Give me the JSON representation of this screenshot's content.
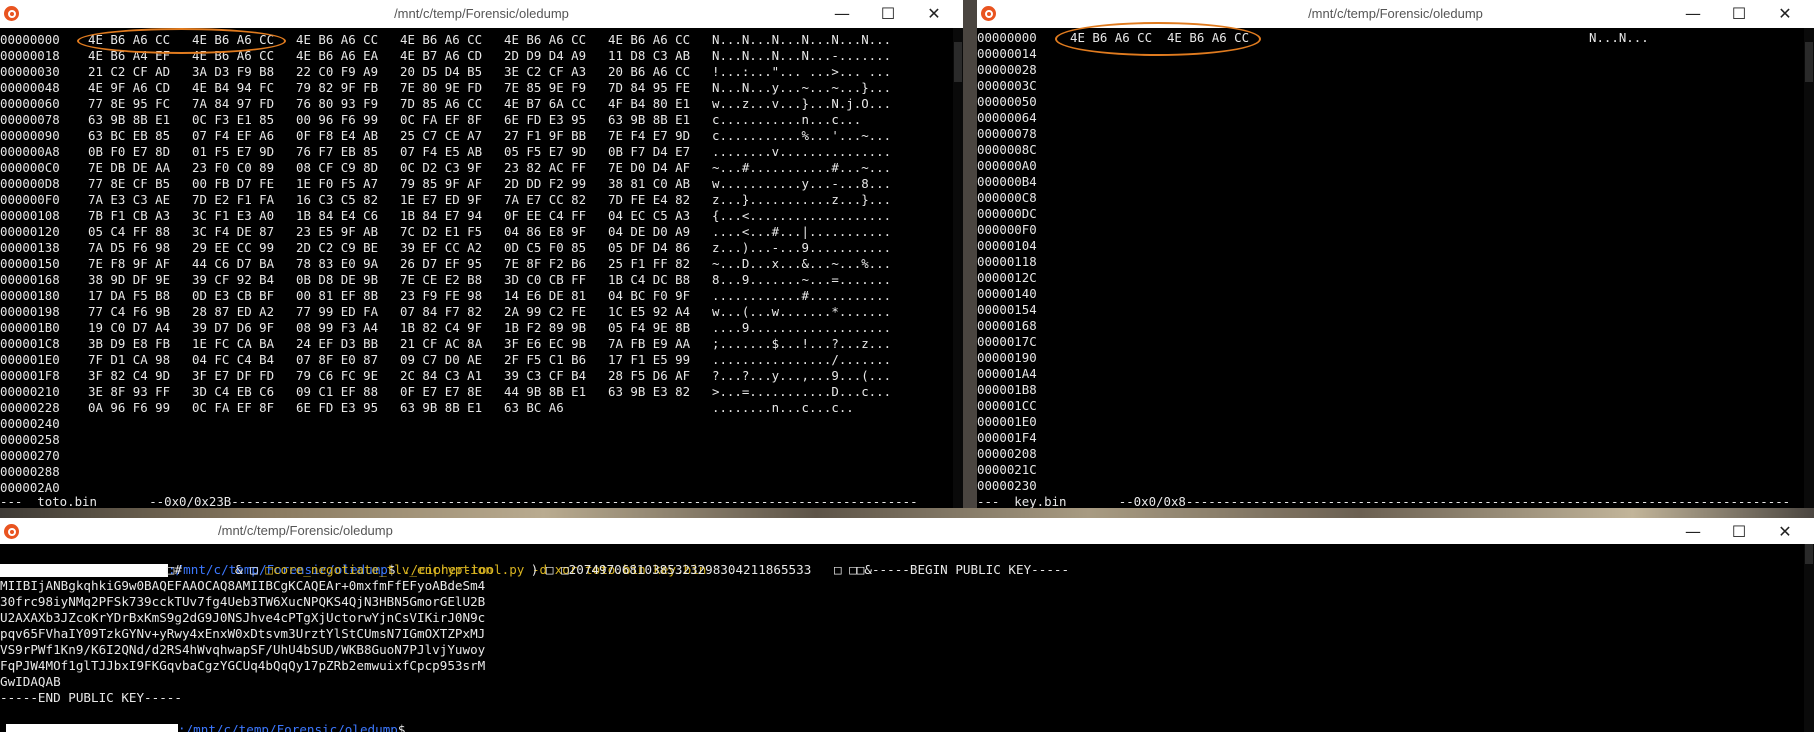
{
  "hex_window_left": {
    "title": "/mnt/c/temp/Forensic/oledump",
    "controls": [
      "—",
      "☐",
      "✕"
    ],
    "rows": [
      {
        "offset": "00000000",
        "groups": [
          "4E B6 A6 CC",
          "4E B6 A6 CC",
          "4E B6 A6 CC",
          "4E B6 A6 CC",
          "4E B6 A6 CC",
          "4E B6 A6 CC"
        ],
        "ascii": "N...N...N...N...N...N..."
      },
      {
        "offset": "00000018",
        "groups": [
          "4E B6 A4 EF",
          "4E B6 A6 CC",
          "4E B6 A6 EA",
          "4E B7 A6 CD",
          "2D D9 D4 A9",
          "11 D8 C3 AB"
        ],
        "ascii": "N...N...N...N...-......."
      },
      {
        "offset": "00000030",
        "groups": [
          "21 C2 CF AD",
          "3A D3 F9 B8",
          "22 C0 F9 A9",
          "20 D5 D4 B5",
          "3E C2 CF A3",
          "20 B6 A6 CC"
        ],
        "ascii": "!...:...\"... ...>... ..."
      },
      {
        "offset": "00000048",
        "groups": [
          "4E 9F A6 CD",
          "4E B4 94 FC",
          "79 82 9F FB",
          "7E 80 9E FD",
          "7E 85 9E F9",
          "7D 84 95 FE"
        ],
        "ascii": "N...N...y...~...~...}..."
      },
      {
        "offset": "00000060",
        "groups": [
          "77 8E 95 FC",
          "7A 84 97 FD",
          "76 80 93 F9",
          "7D 85 A6 CC",
          "4E B7 6A CC",
          "4F B4 80 E1"
        ],
        "ascii": "w...z...v...}...N.j.O..."
      },
      {
        "offset": "00000078",
        "groups": [
          "63 9B 8B E1",
          "0C F3 E1 85",
          "00 96 F6 99",
          "0C FA EF 8F",
          "6E FD E3 95",
          "63 9B 8B E1"
        ],
        "ascii": "c...........n...c..."
      },
      {
        "offset": "00000090",
        "groups": [
          "63 BC EB 85",
          "07 F4 EF A6",
          "0F F8 E4 AB",
          "25 C7 CE A7",
          "27 F1 9F BB",
          "7E F4 E7 9D"
        ],
        "ascii": "c...........%...'...~..."
      },
      {
        "offset": "000000A8",
        "groups": [
          "0B F0 E7 8D",
          "01 F5 E7 9D",
          "76 F7 EB 85",
          "07 F4 E5 AB",
          "05 F5 E7 9D",
          "0B F7 D4 E7"
        ],
        "ascii": "........v..............."
      },
      {
        "offset": "000000C0",
        "groups": [
          "7E DB DE AA",
          "23 F0 C0 89",
          "08 CF C9 8D",
          "0C D2 C3 9F",
          "23 82 AC FF",
          "7E D0 D4 AF"
        ],
        "ascii": "~...#...........#...~..."
      },
      {
        "offset": "000000D8",
        "groups": [
          "77 8E CF B5",
          "00 FB D7 FE",
          "1E F0 F5 A7",
          "79 85 9F AF",
          "2D DD F2 99",
          "38 81 C0 AB"
        ],
        "ascii": "w...........y...-...8..."
      },
      {
        "offset": "000000F0",
        "groups": [
          "7A E3 C3 AE",
          "7D E2 F1 FA",
          "16 C3 C5 82",
          "1E E7 ED 9F",
          "7A E7 CC 82",
          "7D FE E4 82"
        ],
        "ascii": "z...}...........z...}..."
      },
      {
        "offset": "00000108",
        "groups": [
          "7B F1 CB A3",
          "3C F1 E3 A0",
          "1B 84 E4 C6",
          "1B 84 E7 94",
          "0F EE C4 FF",
          "04 EC C5 A3"
        ],
        "ascii": "{...<..................."
      },
      {
        "offset": "00000120",
        "groups": [
          "05 C4 FF 88",
          "3C F4 DE 87",
          "23 E5 9F AB",
          "7C D2 E1 F5",
          "04 86 E8 9F",
          "04 DE D0 A9"
        ],
        "ascii": "....<...#...|..........."
      },
      {
        "offset": "00000138",
        "groups": [
          "7A D5 F6 98",
          "29 EE CC 99",
          "2D C2 C9 BE",
          "39 EF CC A2",
          "0D C5 F0 85",
          "05 DF D4 86"
        ],
        "ascii": "z...)...-...9..........."
      },
      {
        "offset": "00000150",
        "groups": [
          "7E F8 9F AF",
          "44 C6 D7 BA",
          "78 83 E0 9A",
          "26 D7 EF 95",
          "7E 8F F2 B6",
          "25 F1 FF 82"
        ],
        "ascii": "~...D...x...&...~...%..."
      },
      {
        "offset": "00000168",
        "groups": [
          "38 9D DF 9E",
          "39 CF 92 B4",
          "0B D8 DE 9B",
          "7E CE E2 B8",
          "3D C0 CB FF",
          "1B C4 DC B8"
        ],
        "ascii": "8...9.......~...=......."
      },
      {
        "offset": "00000180",
        "groups": [
          "17 DA F5 B8",
          "0D E3 CB BF",
          "00 81 EF 8B",
          "23 F9 FE 98",
          "14 E6 DE 81",
          "04 BC F0 9F"
        ],
        "ascii": "............#..........."
      },
      {
        "offset": "00000198",
        "groups": [
          "77 C4 F6 9B",
          "28 87 ED A2",
          "77 99 ED FA",
          "07 84 F7 82",
          "2A 99 C2 FE",
          "1C E5 92 A4"
        ],
        "ascii": "w...(...w.......*......."
      },
      {
        "offset": "000001B0",
        "groups": [
          "19 C0 D7 A4",
          "39 D7 D6 9F",
          "08 99 F3 A4",
          "1B 82 C4 9F",
          "1B F2 89 9B",
          "05 F4 9E 8B"
        ],
        "ascii": "....9..................."
      },
      {
        "offset": "000001C8",
        "groups": [
          "3B D9 E8 FB",
          "1E FC CA BA",
          "24 EF D3 BB",
          "21 CF AC 8A",
          "3F E6 EC 9B",
          "7A FB E9 AA"
        ],
        "ascii": ";.......$...!...?...z..."
      },
      {
        "offset": "000001E0",
        "groups": [
          "7F D1 CA 98",
          "04 FC C4 B4",
          "07 8F E0 87",
          "09 C7 D0 AE",
          "2F F5 C1 B6",
          "17 F1 E5 99"
        ],
        "ascii": "................/......."
      },
      {
        "offset": "000001F8",
        "groups": [
          "3F 82 C4 9D",
          "3F E7 DF FD",
          "79 C6 FC 9E",
          "2C 84 C3 A1",
          "39 C3 CF B4",
          "28 F5 D6 AF"
        ],
        "ascii": "?...?...y...,...9...(..."
      },
      {
        "offset": "00000210",
        "groups": [
          "3E 8F 93 FF",
          "3D C4 EB C6",
          "09 C1 EF 88",
          "0F E7 E7 8E",
          "44 9B 8B E1",
          "63 9B E3 82"
        ],
        "ascii": ">...=...........D...c..."
      },
      {
        "offset": "00000228",
        "groups": [
          "0A 96 F6 99",
          "0C FA EF 8F",
          "6E FD E3 95",
          "63 9B 8B E1",
          "63 BC A6",
          ""
        ],
        "ascii": "........n...c...c.."
      },
      {
        "offset": "00000240",
        "groups": [
          "",
          "",
          "",
          "",
          "",
          ""
        ],
        "ascii": ""
      },
      {
        "offset": "00000258",
        "groups": [
          "",
          "",
          "",
          "",
          "",
          ""
        ],
        "ascii": ""
      },
      {
        "offset": "00000270",
        "groups": [
          "",
          "",
          "",
          "",
          "",
          ""
        ],
        "ascii": ""
      },
      {
        "offset": "00000288",
        "groups": [
          "",
          "",
          "",
          "",
          "",
          ""
        ],
        "ascii": ""
      },
      {
        "offset": "000002A0",
        "groups": [
          "",
          "",
          "",
          "",
          "",
          ""
        ],
        "ascii": ""
      }
    ],
    "status": "---  toto.bin       --0x0/0x23B--------------------------------------------------------------------------------------------"
  },
  "hex_window_right": {
    "title": "/mnt/c/temp/Forensic/oledump",
    "controls": [
      "—",
      "☐",
      "✕"
    ],
    "rows": [
      {
        "offset": "00000000",
        "hex": "4E B6 A6 CC  4E B6 A6 CC",
        "ascii": "N...N..."
      },
      {
        "offset": "00000014",
        "hex": "",
        "ascii": ""
      },
      {
        "offset": "00000028",
        "hex": "",
        "ascii": ""
      },
      {
        "offset": "0000003C",
        "hex": "",
        "ascii": ""
      },
      {
        "offset": "00000050",
        "hex": "",
        "ascii": ""
      },
      {
        "offset": "00000064",
        "hex": "",
        "ascii": ""
      },
      {
        "offset": "00000078",
        "hex": "",
        "ascii": ""
      },
      {
        "offset": "0000008C",
        "hex": "",
        "ascii": ""
      },
      {
        "offset": "000000A0",
        "hex": "",
        "ascii": ""
      },
      {
        "offset": "000000B4",
        "hex": "",
        "ascii": ""
      },
      {
        "offset": "000000C8",
        "hex": "",
        "ascii": ""
      },
      {
        "offset": "000000DC",
        "hex": "",
        "ascii": ""
      },
      {
        "offset": "000000F0",
        "hex": "",
        "ascii": ""
      },
      {
        "offset": "00000104",
        "hex": "",
        "ascii": ""
      },
      {
        "offset": "00000118",
        "hex": "",
        "ascii": ""
      },
      {
        "offset": "0000012C",
        "hex": "",
        "ascii": ""
      },
      {
        "offset": "00000140",
        "hex": "",
        "ascii": ""
      },
      {
        "offset": "00000154",
        "hex": "",
        "ascii": ""
      },
      {
        "offset": "00000168",
        "hex": "",
        "ascii": ""
      },
      {
        "offset": "0000017C",
        "hex": "",
        "ascii": ""
      },
      {
        "offset": "00000190",
        "hex": "",
        "ascii": ""
      },
      {
        "offset": "000001A4",
        "hex": "",
        "ascii": ""
      },
      {
        "offset": "000001B8",
        "hex": "",
        "ascii": ""
      },
      {
        "offset": "000001CC",
        "hex": "",
        "ascii": ""
      },
      {
        "offset": "000001E0",
        "hex": "",
        "ascii": ""
      },
      {
        "offset": "000001F4",
        "hex": "",
        "ascii": ""
      },
      {
        "offset": "00000208",
        "hex": "",
        "ascii": ""
      },
      {
        "offset": "0000021C",
        "hex": "",
        "ascii": ""
      },
      {
        "offset": "00000230",
        "hex": "",
        "ascii": ""
      }
    ],
    "status": "---  key.bin       --0x0/0x8---------------------------------------------------------------------------------"
  },
  "terminal_window": {
    "title": "/mnt/c/temp/Forensic/oledump",
    "controls": [
      "—",
      "☐",
      "✕"
    ],
    "prompt_path": ":/mnt/c/temp/Forensic/oledump",
    "prompt_symbol": "$",
    "command": " ./cipher-tool.py -d xor toto.bin key.bin",
    "output_line_1_a": "                      □#       & □ ",
    "output_line_1_b": "□core_negotiate_tlv_encryption",
    "output_line_1_c": "     ) □ □20749706810385323298304211865533   □ □□&-----BEGIN PUBLIC KEY-----",
    "key_lines": [
      "MIIBIjANBgkqhkiG9w0BAQEFAAOCAQ8AMIIBCgKCAQEAr+0mxfmFfEFyoABdeSm4",
      "30frc98iyNMq2PFSk739cckTUv7fg4Ueb3TW6XucNPQKS4QjN3HBN5GmorGElU2B",
      "U2AXAXb3JZcoKrYDrBxKmS9g2dG9J0NSJhve4cPTgXjUctorwYjnCsVIKirJ0N9c",
      "pqv65FVhaIY09TzkGYNv+yRwy4xEnxW0xDtsvm3UrztYlStCUmsN7IGmOXTZPxMJ",
      "VS9rPWf1Kn9/K6I2QNd/d2RS4hWvqhwapSF/UhU4bSUD/WKB8GuoN7PJlvjYuwoy",
      "FqPJW4MOf1glTJJbxI9FKGqvbaCgzYGCUq4bQqQy17pZRb2emwuixfCpcp953srM",
      "GwIDAQAB",
      "-----END PUBLIC KEY-----"
    ]
  },
  "colors": {
    "terminal_bg": "#000000",
    "text": "#e8e8e8",
    "prompt_path": "#3c78ff",
    "command": "#d8b320",
    "annotation": "#e07b1f",
    "app_icon": "#e95420"
  },
  "icons": [
    "ubuntu-app-icon",
    "minimize-icon",
    "maximize-icon",
    "close-icon"
  ]
}
